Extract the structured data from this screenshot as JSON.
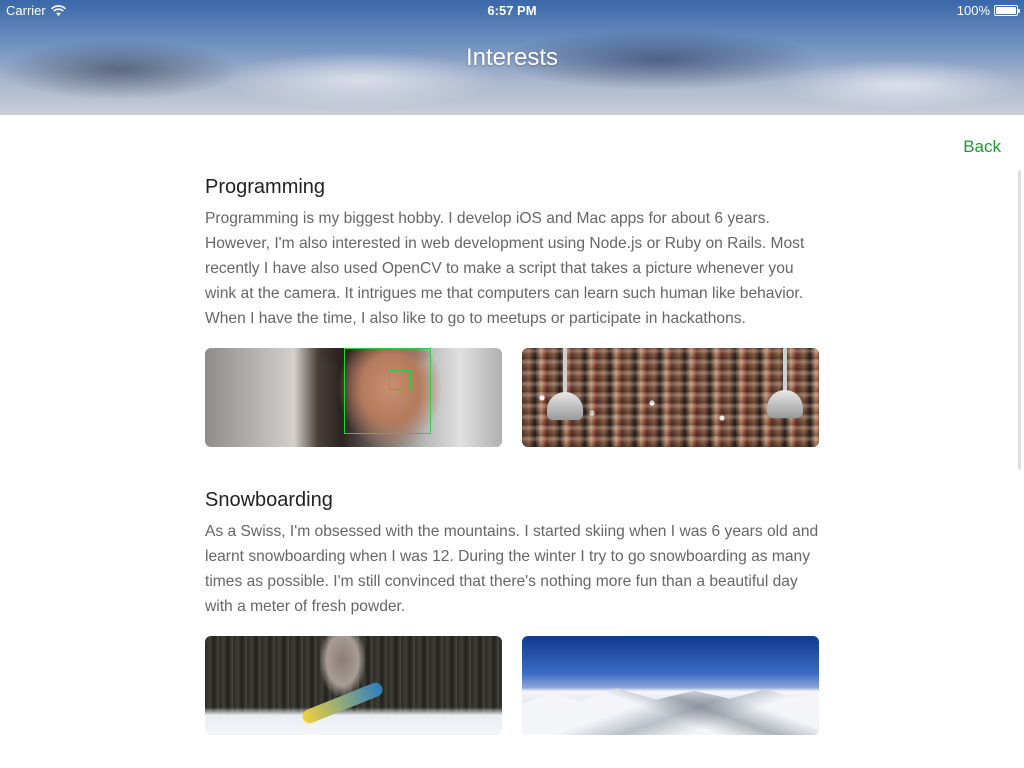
{
  "status_bar": {
    "carrier": "Carrier",
    "time": "6:57 PM",
    "battery": "100%",
    "battery_level": 1.0
  },
  "nav": {
    "title": "Interests",
    "back_label": "Back",
    "accent_color": "#1e9a2f"
  },
  "sections": [
    {
      "title": "Programming",
      "text": "Programming is my biggest hobby. I develop iOS and Mac apps for about 6 years. However, I'm also interested in web development using Node.js or Ruby on Rails. Most recently I have also used OpenCV to make a script that takes a picture whenever you wink at the camera. It intrigues me that computers can learn such human like behavior. When I have the time, I also like to go to meetups or participate in hackathons.",
      "images": [
        "face-detection-photo",
        "hackathon-crowd-photo"
      ]
    },
    {
      "title": "Snowboarding",
      "text": "As a Swiss, I'm obsessed with the mountains. I started skiing when I was 6 years old and learnt snowboarding when I was 12. During the winter I try to go snowboarding as many times as possible. I'm still convinced that there's nothing more fun than a beautiful day with a meter of fresh powder.",
      "images": [
        "snowboard-jump-photo",
        "mountain-panorama-photo"
      ]
    }
  ]
}
